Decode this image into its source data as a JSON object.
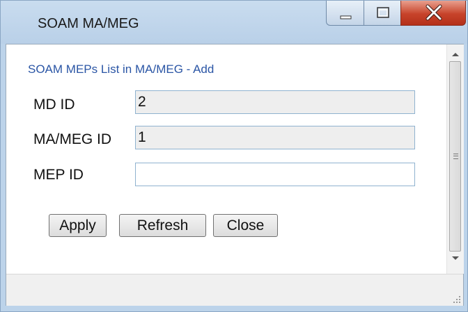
{
  "window": {
    "title": "SOAM MA/MEG"
  },
  "form": {
    "heading": "SOAM MEPs List in MA/MEG - Add",
    "fields": [
      {
        "label": "MD ID",
        "value": "2",
        "editable": false
      },
      {
        "label": "MA/MEG ID",
        "value": "1",
        "editable": false
      },
      {
        "label": "MEP ID",
        "value": "",
        "editable": true
      }
    ]
  },
  "buttons": {
    "apply": "Apply",
    "refresh": "Refresh",
    "close": "Close"
  },
  "icons": {
    "minimize": "minimize-icon",
    "maximize": "maximize-icon",
    "close": "close-icon"
  },
  "colors": {
    "title_bar": "#b9d0e8",
    "heading_text": "#2a55a5",
    "close_button": "#c7432a"
  }
}
